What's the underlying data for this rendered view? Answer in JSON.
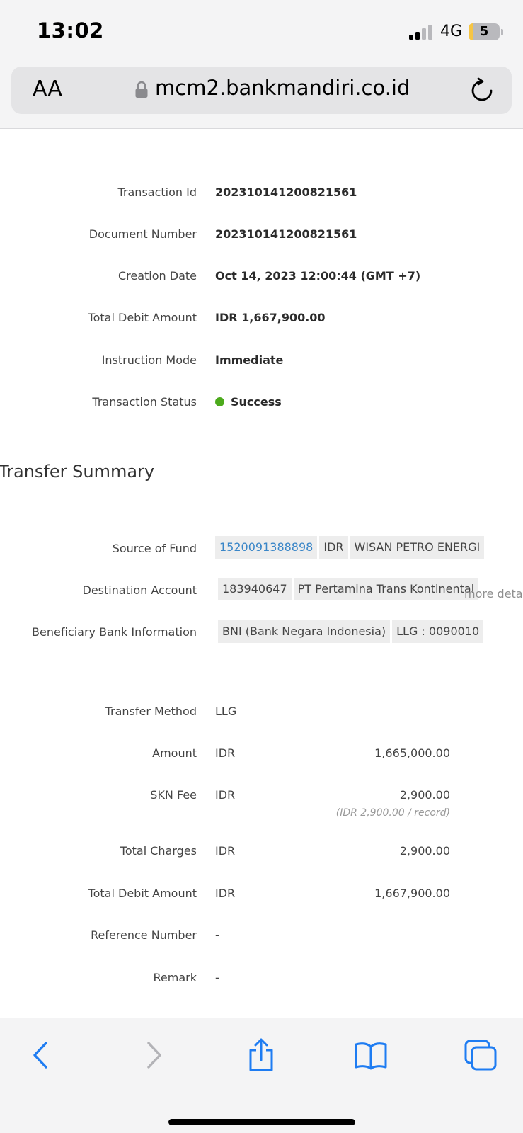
{
  "status_bar": {
    "time": "13:02",
    "network": "4G",
    "battery": "5"
  },
  "browser": {
    "text_size_label": "AA",
    "url": "mcm2.bankmandiri.co.id"
  },
  "details": {
    "transaction_id": {
      "label": "Transaction Id",
      "value": "202310141200821561"
    },
    "document_number": {
      "label": "Document Number",
      "value": "202310141200821561"
    },
    "creation_date": {
      "label": "Creation Date",
      "value": "Oct 14, 2023 12:00:44 (GMT +7)"
    },
    "total_debit": {
      "label": "Total Debit Amount",
      "value": "IDR 1,667,900.00"
    },
    "instruction_mode": {
      "label": "Instruction Mode",
      "value": "Immediate"
    },
    "transaction_status": {
      "label": "Transaction Status",
      "value": "Success",
      "color": "#4caa1c"
    }
  },
  "transfer_summary": {
    "title": "Transfer Summary",
    "source_of_fund": {
      "label": "Source of Fund",
      "account": "1520091388898",
      "currency": "IDR",
      "name": "WISAN PETRO ENERGI"
    },
    "destination_account": {
      "label": "Destination Account",
      "account": "183940647",
      "name": "PT Pertamina Trans Kontinental",
      "more_link": "more detail"
    },
    "beneficiary_bank": {
      "label": "Beneficiary Bank Information",
      "bank": "BNI (Bank Negara Indonesia)",
      "code": "LLG : 0090010"
    },
    "transfer_method": {
      "label": "Transfer Method",
      "value": "LLG"
    },
    "amount": {
      "label": "Amount",
      "currency": "IDR",
      "value": "1,665,000.00"
    },
    "skn_fee": {
      "label": "SKN Fee",
      "currency": "IDR",
      "value": "2,900.00",
      "note": "(IDR 2,900.00 / record)"
    },
    "total_charges": {
      "label": "Total Charges",
      "currency": "IDR",
      "value": "2,900.00"
    },
    "total_debit_amount": {
      "label": "Total Debit Amount",
      "currency": "IDR",
      "value": "1,667,900.00"
    },
    "reference_number": {
      "label": "Reference Number",
      "value": "-"
    },
    "remark": {
      "label": "Remark",
      "value": "-"
    }
  },
  "toolbar": {
    "icons": [
      "back-icon",
      "forward-icon",
      "share-icon",
      "bookmarks-icon",
      "tabs-icon"
    ],
    "accent_color": "#1e7cf2"
  }
}
